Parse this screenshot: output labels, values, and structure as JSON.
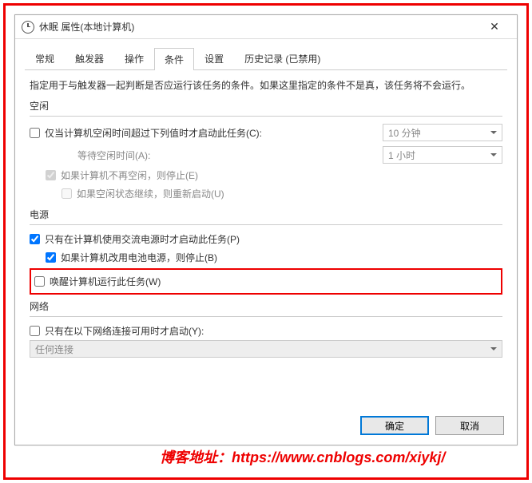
{
  "window": {
    "title": "休眠 属性(本地计算机)"
  },
  "tabs": [
    "常规",
    "触发器",
    "操作",
    "条件",
    "设置",
    "历史记录 (已禁用)"
  ],
  "active_tab": 3,
  "description": "指定用于与触发器一起判断是否应运行该任务的条件。如果这里指定的条件不是真，该任务将不会运行。",
  "sections": {
    "idle": {
      "title": "空闲",
      "start_if_idle": "仅当计算机空闲时间超过下列值时才启动此任务(C):",
      "idle_duration": "10 分钟",
      "wait_label": "等待空闲时间(A):",
      "wait_duration": "1 小时",
      "stop_if_not_idle": "如果计算机不再空闲，则停止(E)",
      "restart_if_idle": "如果空闲状态继续，则重新启动(U)"
    },
    "power": {
      "title": "电源",
      "ac_only": "只有在计算机使用交流电源时才启动此任务(P)",
      "stop_on_battery": "如果计算机改用电池电源，则停止(B)",
      "wake": "唤醒计算机运行此任务(W)"
    },
    "network": {
      "title": "网络",
      "only_if_network": "只有在以下网络连接可用时才启动(Y):",
      "connection": "任何连接"
    }
  },
  "buttons": {
    "ok": "确定",
    "cancel": "取消"
  },
  "watermark": "博客地址：https://www.cnblogs.com/xiykj/"
}
